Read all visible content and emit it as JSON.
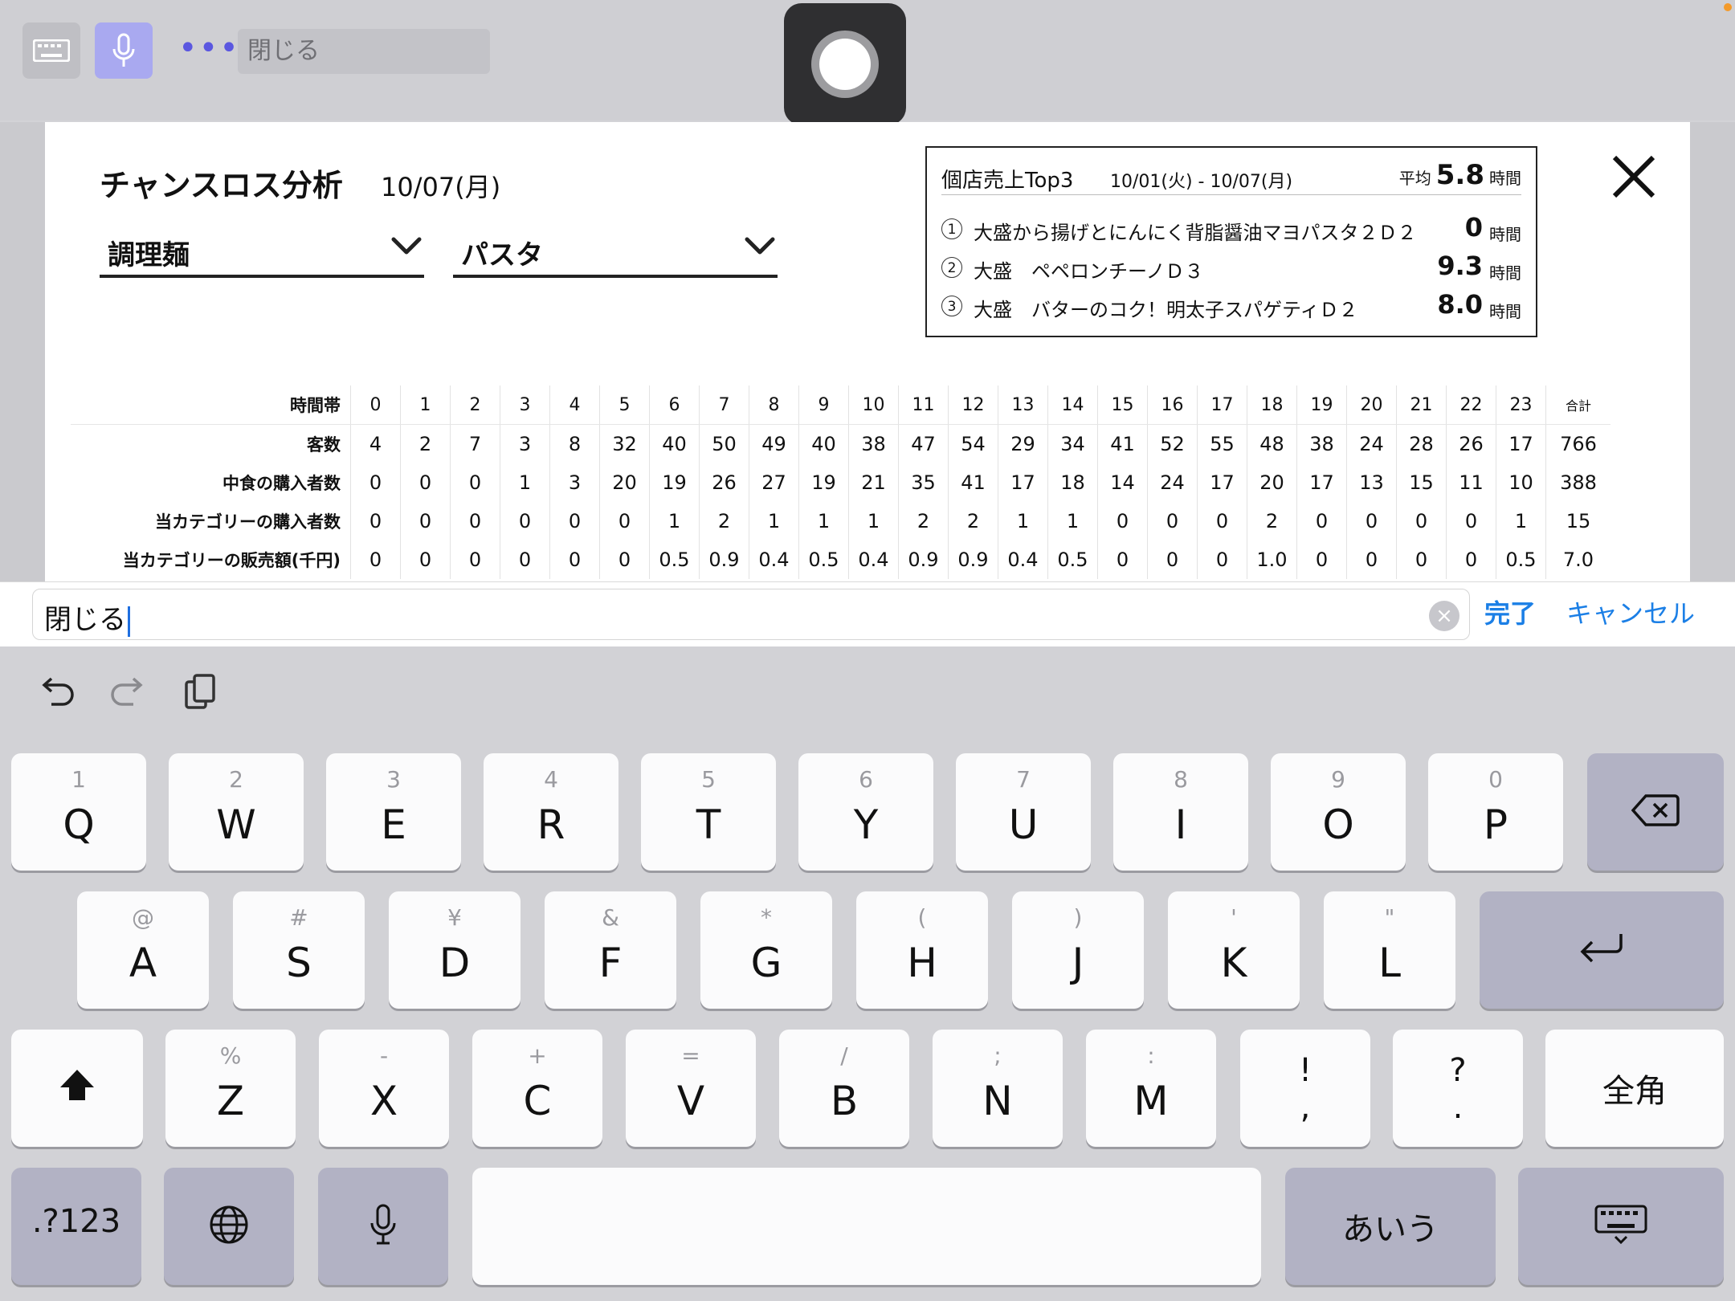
{
  "top_bar": {
    "field_text": "閉じる"
  },
  "panel": {
    "title": "チャンスロス分析",
    "date": "10/07(月)",
    "category_select": "調理麺",
    "subcategory_select": "パスタ"
  },
  "top3": {
    "title": "個店売上Top3",
    "range": "10/01(火) - 10/07(月)",
    "avg_label": "平均",
    "avg_value": "5.8",
    "unit": "時間",
    "items": [
      {
        "rank": "1",
        "name": "大盛から揚げとにんにく背脂醤油マヨパスタ２Ｄ２",
        "hours": "0"
      },
      {
        "rank": "2",
        "name": "大盛　ペペロンチーノＤ３",
        "hours": "9.3"
      },
      {
        "rank": "3",
        "name": "大盛　バターのコク！明太子スパゲティＤ２",
        "hours": "8.0"
      }
    ]
  },
  "table": {
    "header_label": "時間帯",
    "hours": [
      "0",
      "1",
      "2",
      "3",
      "4",
      "5",
      "6",
      "7",
      "8",
      "9",
      "10",
      "11",
      "12",
      "13",
      "14",
      "15",
      "16",
      "17",
      "18",
      "19",
      "20",
      "21",
      "22",
      "23"
    ],
    "total_label": "合計",
    "rows": [
      {
        "label": "客数",
        "values": [
          "4",
          "2",
          "7",
          "3",
          "8",
          "32",
          "40",
          "50",
          "49",
          "40",
          "38",
          "47",
          "54",
          "29",
          "34",
          "41",
          "52",
          "55",
          "48",
          "38",
          "24",
          "28",
          "26",
          "17"
        ],
        "total": "766"
      },
      {
        "label": "中食の購入者数",
        "values": [
          "0",
          "0",
          "0",
          "1",
          "3",
          "20",
          "19",
          "26",
          "27",
          "19",
          "21",
          "35",
          "41",
          "17",
          "18",
          "14",
          "24",
          "17",
          "20",
          "17",
          "13",
          "15",
          "11",
          "10"
        ],
        "total": "388"
      },
      {
        "label": "当カテゴリーの購入者数",
        "values": [
          "0",
          "0",
          "0",
          "0",
          "0",
          "0",
          "1",
          "2",
          "1",
          "1",
          "1",
          "2",
          "2",
          "1",
          "1",
          "0",
          "0",
          "0",
          "2",
          "0",
          "0",
          "0",
          "0",
          "1"
        ],
        "total": "15"
      },
      {
        "label": "当カテゴリーの販売額(千円)",
        "values": [
          "0",
          "0",
          "0",
          "0",
          "0",
          "0",
          "0.5",
          "0.9",
          "0.4",
          "0.5",
          "0.4",
          "0.9",
          "0.9",
          "0.4",
          "0.5",
          "0",
          "0",
          "0",
          "1.0",
          "0",
          "0",
          "0",
          "0",
          "0.5"
        ],
        "total": "7.0"
      }
    ]
  },
  "search": {
    "value": "閉じる",
    "done_label": "完了",
    "cancel_label": "キャンセル"
  },
  "keyboard": {
    "row1": [
      [
        "1",
        "Q"
      ],
      [
        "2",
        "W"
      ],
      [
        "3",
        "E"
      ],
      [
        "4",
        "R"
      ],
      [
        "5",
        "T"
      ],
      [
        "6",
        "Y"
      ],
      [
        "7",
        "U"
      ],
      [
        "8",
        "I"
      ],
      [
        "9",
        "O"
      ],
      [
        "0",
        "P"
      ]
    ],
    "row2": [
      [
        "@",
        "A"
      ],
      [
        "#",
        "S"
      ],
      [
        "¥",
        "D"
      ],
      [
        "&",
        "F"
      ],
      [
        "*",
        "G"
      ],
      [
        "(",
        "H"
      ],
      [
        ")",
        "J"
      ],
      [
        "'",
        "K"
      ],
      [
        "\"",
        "L"
      ]
    ],
    "row3": [
      [
        "%",
        "Z"
      ],
      [
        "-",
        "X"
      ],
      [
        "+",
        "C"
      ],
      [
        "=",
        "V"
      ],
      [
        "/",
        "B"
      ],
      [
        ";",
        "N"
      ],
      [
        ":",
        "M"
      ]
    ],
    "excl": [
      "!",
      ","
    ],
    "quest": [
      "?",
      "."
    ],
    "zenkaku_label": "全角",
    "numbers_label": ".?123",
    "kana_label": "あいう",
    "accent_color": "#1b7fe6"
  }
}
